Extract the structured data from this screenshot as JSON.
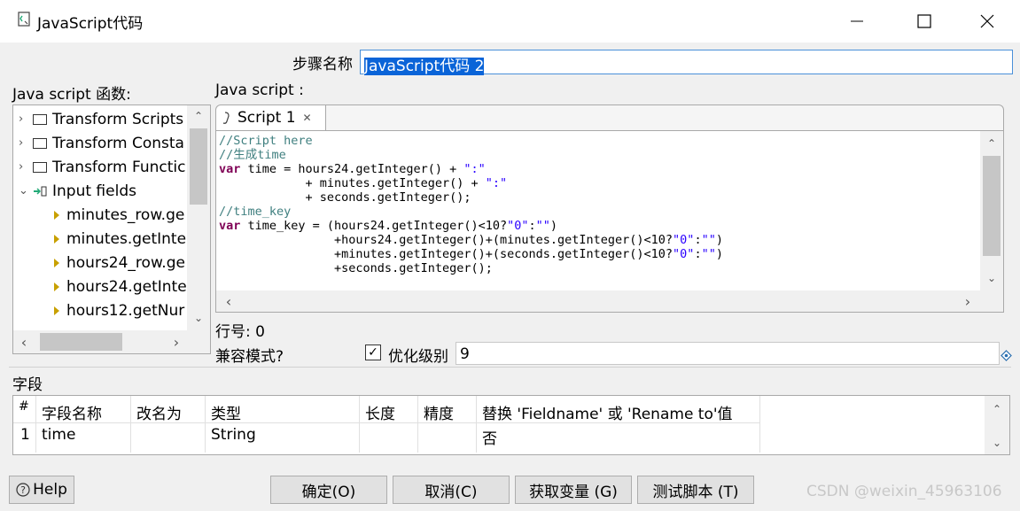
{
  "window": {
    "title": "JavaScript代码",
    "minimize_icon": "minimize-icon",
    "maximize_icon": "maximize-icon",
    "close_icon": "close-icon"
  },
  "step": {
    "label": "步骤名称",
    "value": "JavaScript代码 2"
  },
  "functions_panel": {
    "label": "Java script 函数:",
    "items": [
      {
        "label": "Transform Scripts",
        "type": "folder"
      },
      {
        "label": "Transform Consta",
        "type": "folder"
      },
      {
        "label": "Transform Functic",
        "type": "folder"
      },
      {
        "label": "Input fields",
        "type": "input-fields"
      },
      {
        "label": "minutes_row.ge",
        "type": "field"
      },
      {
        "label": "minutes.getInte",
        "type": "field"
      },
      {
        "label": "hours24_row.ge",
        "type": "field"
      },
      {
        "label": "hours24.getInte",
        "type": "field"
      },
      {
        "label": "hours12.getNur",
        "type": "field"
      }
    ]
  },
  "script_panel": {
    "label": "Java script :",
    "tab_label": "Script 1",
    "code_lines": [
      "//Script here",
      "//生成time",
      "var time = hours24.getInteger() + \":\"",
      "            + minutes.getInteger() + \":\"",
      "            + seconds.getInteger();",
      "//time_key",
      "var time_key = (hours24.getInteger()<10?\"0\":\"\")",
      "                +hours24.getInteger()+(minutes.getInteger()<10?\"0\":\"\")",
      "                +minutes.getInteger()+(seconds.getInteger()<10?\"0\":\"\")",
      "                +seconds.getInteger();"
    ]
  },
  "line_number": "行号: 0",
  "compat_label": "兼容模式?",
  "optimize": {
    "label": "优化级别",
    "value": "9",
    "checked": true
  },
  "fields_section": {
    "label": "字段",
    "columns": [
      "#",
      "字段名称",
      "改名为",
      "类型",
      "长度",
      "精度",
      "替换 'Fieldname' 或 'Rename to'值"
    ],
    "column_wrap": "否",
    "rows": [
      {
        "num": "1",
        "name": "time",
        "rename": "",
        "type": "String",
        "length": "",
        "precision": "",
        "replace": "否"
      }
    ]
  },
  "buttons": {
    "help": "Help",
    "ok": "确定(O)",
    "cancel": "取消(C)",
    "get_vars": "获取变量 (G)",
    "test": "测试脚本 (T)"
  },
  "watermark": "CSDN @weixin_45963106",
  "colors": {
    "selection": "#0a64d8",
    "comment": "#3f7f7f",
    "keyword": "#7f0055",
    "string": "#2a00ff",
    "folder_arrow": "#c8a000"
  }
}
